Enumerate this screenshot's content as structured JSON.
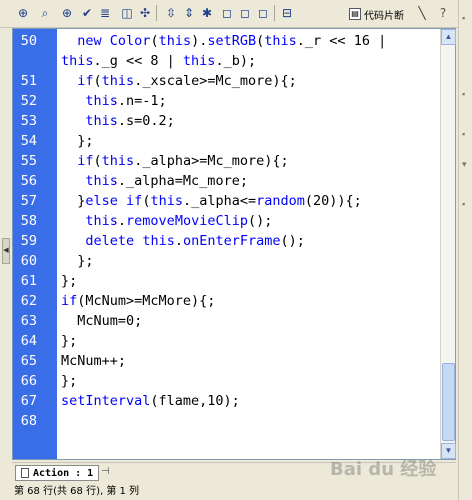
{
  "toolbar": {
    "icons": [
      "add-statement-icon",
      "find-icon",
      "target-icon",
      "check-syntax-icon",
      "auto-format-icon",
      "code-hint-icon",
      "debug-icon",
      "collapse-between-icon",
      "collapse-selection-icon",
      "expand-all-icon",
      "comment-block-icon",
      "comment-line-icon",
      "remove-comment-icon",
      "script-assist-icon"
    ],
    "snippets_label": "代码片断"
  },
  "editor": {
    "lines": [
      {
        "n": "50",
        "text": "  new Color(this).setRGB(this._r << 16 |"
      },
      {
        "n": "",
        "text": "this._g << 8 | this._b);"
      },
      {
        "n": "51",
        "text": "  if(this._xscale>=Mc_more){;"
      },
      {
        "n": "52",
        "text": "   this.n=-1;"
      },
      {
        "n": "53",
        "text": "   this.s=0.2;"
      },
      {
        "n": "54",
        "text": "  };"
      },
      {
        "n": "55",
        "text": "  if(this._alpha>=Mc_more){;"
      },
      {
        "n": "56",
        "text": "   this._alpha=Mc_more;"
      },
      {
        "n": "57",
        "text": "  }else if(this._alpha<=random(20)){;"
      },
      {
        "n": "58",
        "text": "   this.removeMovieClip();"
      },
      {
        "n": "59",
        "text": "   delete this.onEnterFrame();"
      },
      {
        "n": "60",
        "text": "  };"
      },
      {
        "n": "61",
        "text": "};"
      },
      {
        "n": "62",
        "text": "if(McNum>=McMore){;"
      },
      {
        "n": "63",
        "text": "  McNum=0;"
      },
      {
        "n": "64",
        "text": "};"
      },
      {
        "n": "65",
        "text": "McNum++;"
      },
      {
        "n": "66",
        "text": "};"
      },
      {
        "n": "67",
        "text": "setInterval(flame,10);"
      },
      {
        "n": "68",
        "text": ""
      }
    ]
  },
  "tab": {
    "label": "Action : 1"
  },
  "status": {
    "text": "第 68 行(共 68 行), 第 1 列"
  },
  "watermark": "Bai du 经验",
  "colors": {
    "gutter": "#3a6ee8",
    "keyword": "#0000ff"
  }
}
